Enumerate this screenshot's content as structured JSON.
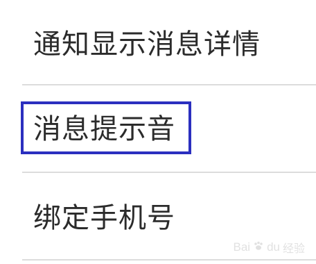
{
  "settings": {
    "items": [
      {
        "label": "通知显示消息详情"
      },
      {
        "label": "消息提示音"
      },
      {
        "label": "绑定手机号"
      }
    ]
  },
  "highlight": {
    "color": "#2b2fbf",
    "target": "消息提示音"
  },
  "watermark": {
    "brand": "Bai",
    "icon": "paw-icon",
    "brand_end": "du",
    "sub": "经验"
  }
}
